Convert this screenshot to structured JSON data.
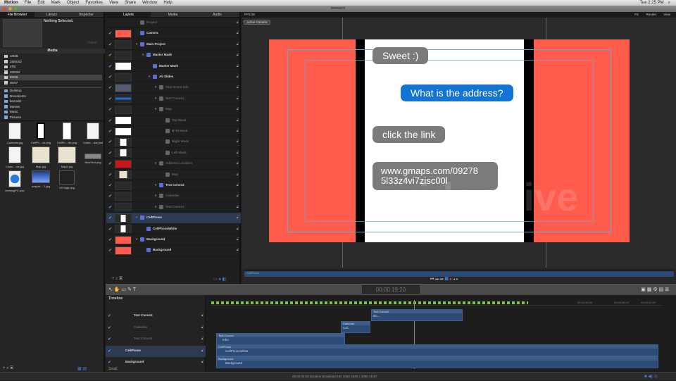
{
  "menubar": {
    "app": "Motion",
    "items": [
      "File",
      "Edit",
      "Mark",
      "Object",
      "Favorites",
      "View",
      "Share",
      "Window",
      "Help"
    ],
    "clock": "Tue 2:25 PM"
  },
  "window": {
    "title": "textovent"
  },
  "left_panel": {
    "tabs": [
      "File Browser",
      "Library",
      "Inspector"
    ],
    "preview_text": "Nothing Selected.",
    "import_label": "Import",
    "location": "Media",
    "drives": [
      "16GB",
      "250SSD",
      "2TB",
      "200GB",
      "80GB",
      "WIN7"
    ],
    "selected_drive": "80GB",
    "folders": [
      "Desktop",
      "Documents",
      "bozovitz",
      "Movies",
      "Music",
      "Pictures"
    ],
    "files": [
      {
        "name": "Calendar.jpg",
        "kind": "doc"
      },
      {
        "name": "CellPh....ck.png",
        "kind": "phone-black"
      },
      {
        "name": "CellPh....ite.png",
        "kind": "phone"
      },
      {
        "name": "Custo....dar.psd",
        "kind": "doc"
      },
      {
        "name": "Custo....ow.jpg",
        "kind": "doc"
      },
      {
        "name": "Map.jpg",
        "kind": "map"
      },
      {
        "name": "Map2.jpg",
        "kind": "map"
      },
      {
        "name": "NewText.png",
        "kind": "bar"
      },
      {
        "name": "textmsgFX.wav",
        "kind": "audio"
      },
      {
        "name": "unspla.....1.jpg",
        "kind": "photo"
      },
      {
        "name": "VH logo.png",
        "kind": "logo"
      }
    ]
  },
  "layers_panel": {
    "tabs": [
      "Layers",
      "Media",
      "Audio"
    ],
    "rows": [
      {
        "name": "Project",
        "indent": 0,
        "dim": true,
        "thumb": "none",
        "check": false
      },
      {
        "name": "Camera",
        "indent": 0,
        "thumb": "red",
        "check": true
      },
      {
        "name": "Main Project",
        "indent": 0,
        "thumb": "dark",
        "check": true,
        "disclosure": true
      },
      {
        "name": "Master Mask",
        "indent": 1,
        "thumb": "dark",
        "check": true,
        "disclosure": true
      },
      {
        "name": "Master Mask",
        "indent": 2,
        "thumb": "white",
        "check": true
      },
      {
        "name": "All Slides",
        "indent": 2,
        "thumb": "dark",
        "check": true,
        "disclosure": true
      },
      {
        "name": "Your Event Info",
        "indent": 3,
        "dim": true,
        "thumb": "photo",
        "check": true,
        "disclosure": true
      },
      {
        "name": "Text Convo1",
        "indent": 3,
        "dim": true,
        "thumb": "blue",
        "check": true,
        "disclosure": true
      },
      {
        "name": "Map",
        "indent": 3,
        "dim": true,
        "thumb": "dark",
        "check": true,
        "disclosure": true
      },
      {
        "name": "Top Mask",
        "indent": 4,
        "dim": true,
        "thumb": "white",
        "check": true
      },
      {
        "name": "BTM Mask",
        "indent": 4,
        "dim": true,
        "thumb": "white",
        "check": true
      },
      {
        "name": "Right Mask",
        "indent": 4,
        "dim": true,
        "thumb": "whitesm",
        "check": true
      },
      {
        "name": "Left Mask",
        "indent": 4,
        "dim": true,
        "thumb": "whitesm",
        "check": true
      },
      {
        "name": "Address Location",
        "indent": 3,
        "dim": true,
        "thumb": "redbar",
        "check": true,
        "disclosure": true
      },
      {
        "name": "Map",
        "indent": 4,
        "dim": true,
        "thumb": "map",
        "check": true
      },
      {
        "name": "Text Convo2",
        "indent": 3,
        "thumb": "dark",
        "check": true,
        "disclosure": true
      },
      {
        "name": "Calendar",
        "indent": 3,
        "dim": true,
        "thumb": "dark",
        "check": true,
        "disclosure": true
      },
      {
        "name": "Text Convo1",
        "indent": 3,
        "dim": true,
        "thumb": "dark",
        "check": true,
        "disclosure": true
      },
      {
        "name": "CellPhone",
        "indent": 0,
        "thumb": "phone",
        "check": true,
        "disclosure": true,
        "selected": true
      },
      {
        "name": "CellPhoneWhite",
        "indent": 1,
        "thumb": "phone",
        "check": true
      },
      {
        "name": "Background",
        "indent": 0,
        "thumb": "red",
        "check": true,
        "disclosure": true
      },
      {
        "name": "Background",
        "indent": 1,
        "thumb": "red",
        "check": true
      }
    ]
  },
  "canvas": {
    "fps": "FPS:30",
    "camera": "Active Camera",
    "fit": "Fit:",
    "render": "Render",
    "view": "View",
    "bubbles": [
      {
        "text": "Sweet :)",
        "side": "left"
      },
      {
        "text": "What is the address?",
        "side": "right"
      },
      {
        "text": "click the link",
        "side": "left"
      },
      {
        "text": "www.gmaps.com/09278 5l33z4vi7zisc00l",
        "side": "left"
      }
    ],
    "watermark": "videohive",
    "mini_track": "CellPhone"
  },
  "colors": {
    "background_red": "#ff5c4d",
    "bubble_gray": "#7b7b7b",
    "bubble_blue": "#1474d4",
    "accent": "#3c6fd8"
  },
  "toolbar": {
    "timecode": "00:00:19:20"
  },
  "timeline": {
    "title": "Timeline",
    "size_label": "Small",
    "rows": [
      {
        "name": "Text Convo2",
        "dim": false
      },
      {
        "name": "Calendar",
        "dim": true
      },
      {
        "name": "Text Convo1",
        "dim": true
      },
      {
        "name": "CellPhone",
        "dim": false,
        "selected": true
      },
      {
        "name": "Background",
        "dim": false
      }
    ],
    "ruler": [
      "00:00:36:00",
      "00:00:38:00",
      "00:00:42:00"
    ],
    "clips": [
      {
        "title": "Text Convo2",
        "sub": "Bu...."
      },
      {
        "title": "Calendar",
        "sub": "Cal..."
      },
      {
        "title": "Text Convo1",
        "sub": "Inbo"
      },
      {
        "title": "CellPhone",
        "sub": "CellPhoneWhite"
      },
      {
        "title": "Background",
        "sub": "Background"
      }
    ]
  },
  "status": {
    "text": "00:00:44;00 duration Broadcast HD 1080 1920 x 1080 29.97"
  }
}
